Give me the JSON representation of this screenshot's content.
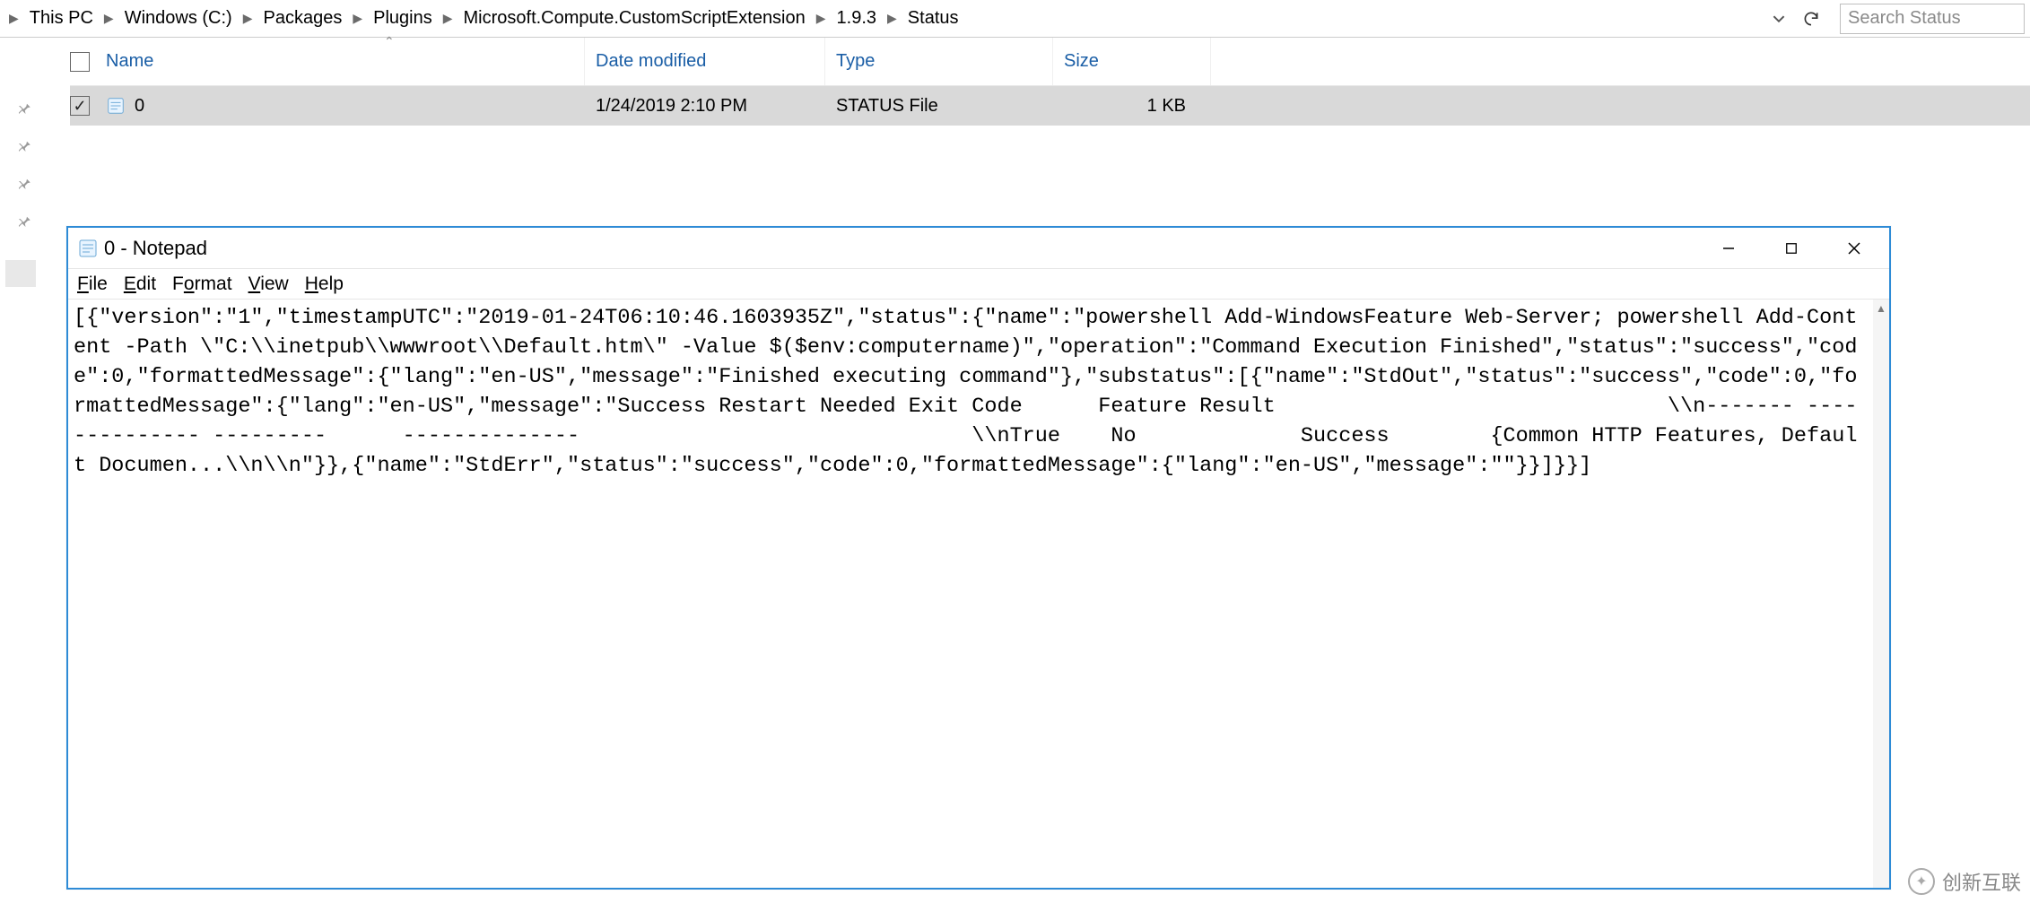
{
  "breadcrumbs": [
    "This PC",
    "Windows (C:)",
    "Packages",
    "Plugins",
    "Microsoft.Compute.CustomScriptExtension",
    "1.9.3",
    "Status"
  ],
  "search": {
    "placeholder": "Search Status"
  },
  "columns": {
    "name": "Name",
    "date": "Date modified",
    "type": "Type",
    "size": "Size"
  },
  "rows": [
    {
      "name": "0",
      "date": "1/24/2019 2:10 PM",
      "type": "STATUS File",
      "size": "1 KB",
      "checked": true
    }
  ],
  "notepad": {
    "title": "0 - Notepad",
    "menus": {
      "file": "File",
      "edit": "Edit",
      "format": "Format",
      "view": "View",
      "help": "Help"
    },
    "content": "[{\"version\":\"1\",\"timestampUTC\":\"2019-01-24T06:10:46.1603935Z\",\"status\":{\"name\":\"powershell Add-WindowsFeature Web-Server; powershell Add-Content -Path \\\"C:\\\\inetpub\\\\wwwroot\\\\Default.htm\\\" -Value $($env:computername)\",\"operation\":\"Command Execution Finished\",\"status\":\"success\",\"code\":0,\"formattedMessage\":{\"lang\":\"en-US\",\"message\":\"Finished executing command\"},\"substatus\":[{\"name\":\"StdOut\",\"status\":\"success\",\"code\":0,\"formattedMessage\":{\"lang\":\"en-US\",\"message\":\"Success Restart Needed Exit Code      Feature Result                               \\\\n------- -------------- ---------      --------------                               \\\\nTrue    No             Success        {Common HTTP Features, Default Documen...\\\\n\\\\n\"}},{\"name\":\"StdErr\",\"status\":\"success\",\"code\":0,\"formattedMessage\":{\"lang\":\"en-US\",\"message\":\"\"}}]}}]"
  },
  "watermark": {
    "text": "创新互联"
  }
}
